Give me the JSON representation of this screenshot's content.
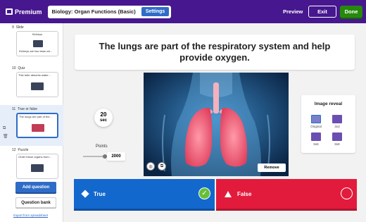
{
  "header": {
    "brand": "Premium",
    "title": "Biology: Organ Functions (Basic)",
    "settings_label": "Settings",
    "preview_label": "Preview",
    "exit_label": "Exit",
    "done_label": "Done"
  },
  "sidebar": {
    "slides": [
      {
        "number": "9",
        "type": "Slide",
        "title": "Kidneys",
        "text": "Kidneys are two bean-sh..."
      },
      {
        "number": "10",
        "type": "Quiz",
        "text": "This tube absorbs water..."
      },
      {
        "number": "11",
        "type": "True or false",
        "text": "The lungs are part of the..."
      },
      {
        "number": "12",
        "type": "Puzzle",
        "text": "Order these organs from..."
      }
    ],
    "add_question_label": "Add question",
    "question_bank_label": "Question bank",
    "import_label": "Import from spreadsheet"
  },
  "editor": {
    "question": "The lungs are part of the respiratory system and help provide oxygen.",
    "timer_value": "20",
    "timer_unit": "sec",
    "points_label": "Points",
    "points_value": "2000",
    "remove_label": "Remove"
  },
  "image_reveal": {
    "heading": "Image reveal",
    "options": [
      "Original",
      "3x3",
      "5x5",
      "8x8"
    ],
    "selected": "Original"
  },
  "answers": [
    {
      "label": "True",
      "color": "#1368ce",
      "correct": true
    },
    {
      "label": "False",
      "color": "#e21b3c",
      "correct": false
    }
  ],
  "colors": {
    "topbar": "#46178f",
    "accent": "#2f6cc7",
    "done": "#26890c"
  }
}
